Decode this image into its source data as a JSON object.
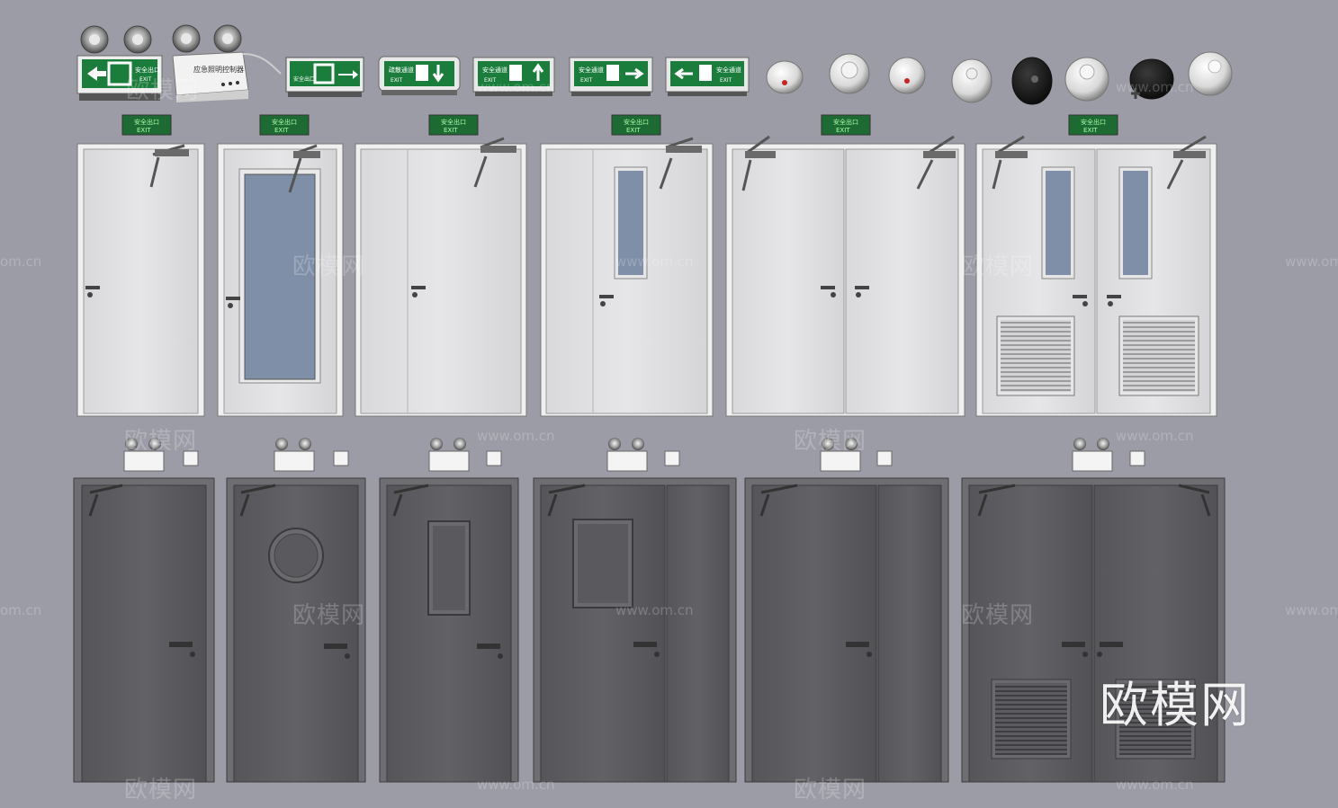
{
  "watermark": {
    "brand_cn": "欧模网",
    "url": "www.om.cn",
    "url_cropped": "om.cn"
  },
  "signs": {
    "exit_cn": "安全出口",
    "exit_en": "EXIT",
    "passage_cn": "安全通道",
    "evac_cn": "疏散通道",
    "sign_color": "#1a7a3a"
  },
  "colors": {
    "background": "#9c9ca6",
    "white_door": "#e2e2e2",
    "gray_door": "#5e5e62",
    "glass": "#7f8fa8"
  }
}
